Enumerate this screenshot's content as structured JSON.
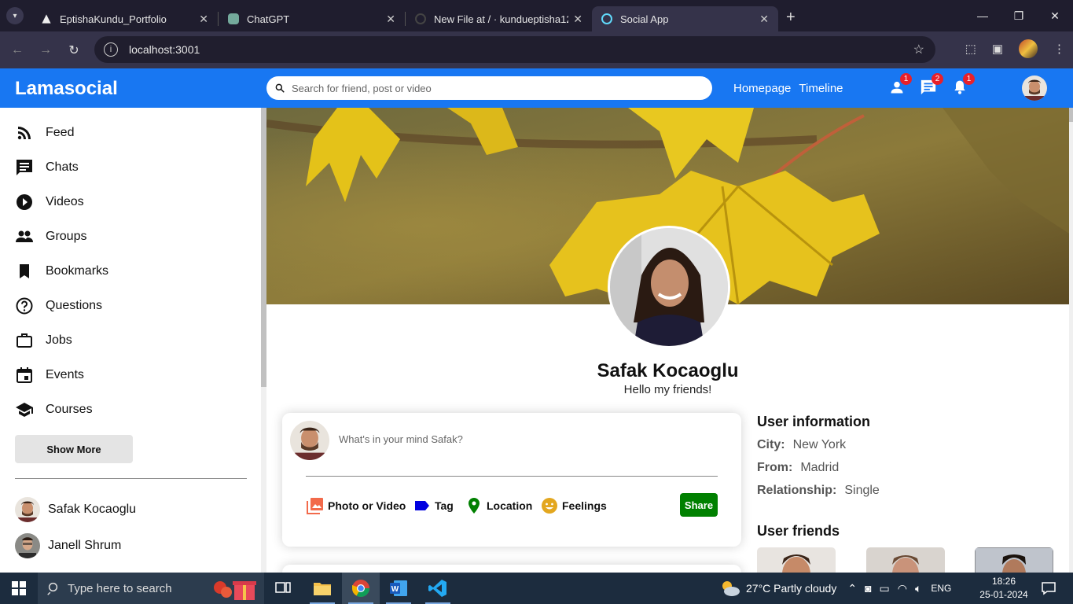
{
  "browser": {
    "tabs": [
      {
        "label": "EptishaKundu_Portfolio",
        "favicon_color": "#111111"
      },
      {
        "label": "ChatGPT",
        "favicon_color": "#74aa9c"
      },
      {
        "label": "New File at / · kundueptisha12/",
        "favicon_color": "#222222"
      },
      {
        "label": "Social App",
        "favicon_color": "#61dafb"
      }
    ],
    "active_tab": 3,
    "url": "localhost:3001"
  },
  "app": {
    "logo": "Lamasocial",
    "search_placeholder": "Search for friend, post or video",
    "nav_links": [
      "Homepage",
      "Timeline"
    ],
    "badges": {
      "friends": "1",
      "messages": "2",
      "notifications": "1"
    },
    "brand_color": "#1877f2"
  },
  "sidebar": {
    "items": [
      {
        "label": "Feed",
        "icon": "rss-icon"
      },
      {
        "label": "Chats",
        "icon": "chat-icon"
      },
      {
        "label": "Videos",
        "icon": "play-circle-icon"
      },
      {
        "label": "Groups",
        "icon": "group-icon"
      },
      {
        "label": "Bookmarks",
        "icon": "bookmark-icon"
      },
      {
        "label": "Questions",
        "icon": "help-circle-icon"
      },
      {
        "label": "Jobs",
        "icon": "briefcase-icon"
      },
      {
        "label": "Events",
        "icon": "calendar-icon"
      },
      {
        "label": "Courses",
        "icon": "school-icon"
      }
    ],
    "show_more": "Show More",
    "friends": [
      "Safak Kocaoglu",
      "Janell Shrum"
    ]
  },
  "profile": {
    "name": "Safak Kocaoglu",
    "description": "Hello my friends!"
  },
  "share": {
    "placeholder": "What's in your mind Safak?",
    "options": [
      "Photo or Video",
      "Tag",
      "Location",
      "Feelings"
    ],
    "button": "Share"
  },
  "rightbar": {
    "info_title": "User information",
    "info": [
      {
        "key": "City:",
        "value": "New York"
      },
      {
        "key": "From:",
        "value": "Madrid"
      },
      {
        "key": "Relationship:",
        "value": "Single"
      }
    ],
    "friends_title": "User friends"
  },
  "taskbar": {
    "search_placeholder": "Type here to search",
    "weather": "27°C  Partly cloudy",
    "lang": "ENG",
    "time": "18:26",
    "date": "25-01-2024"
  }
}
